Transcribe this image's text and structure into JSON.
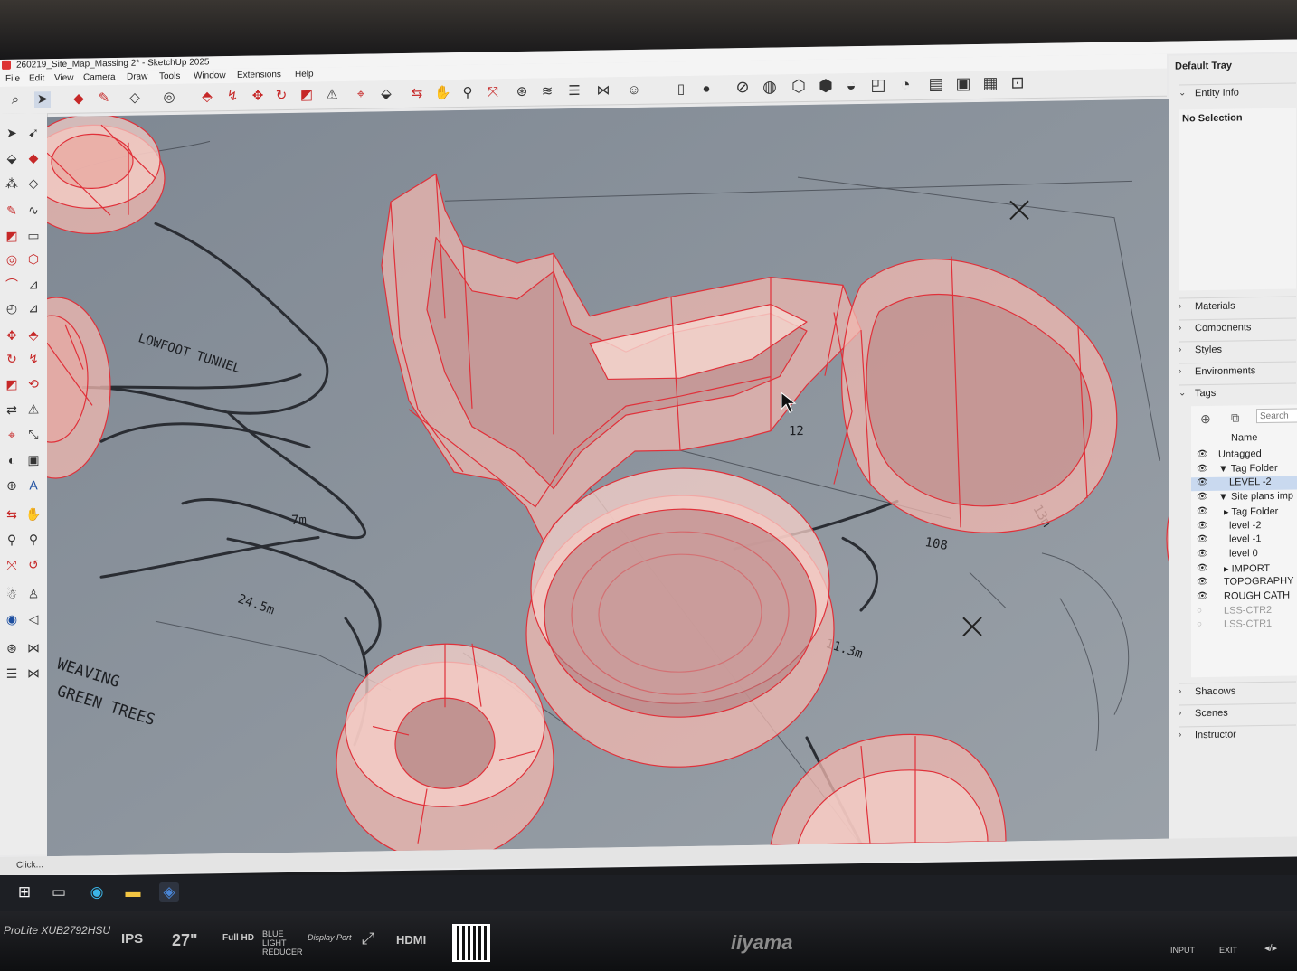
{
  "window": {
    "title": "260219_Site_Map_Massing 2* - SketchUp 2025"
  },
  "menu": [
    "File",
    "Edit",
    "View",
    "Camera",
    "Draw",
    "Tools",
    "Window",
    "Extensions",
    "Help"
  ],
  "tray": {
    "title": "Default Tray",
    "entity_info": {
      "label": "Entity Info",
      "status": "No Selection"
    },
    "panels_collapsed": [
      "Materials",
      "Components",
      "Styles",
      "Environments"
    ],
    "tags": {
      "label": "Tags",
      "search_placeholder": "Search",
      "column_name": "Name",
      "rows": [
        {
          "name": "Untagged",
          "indent": 0,
          "visible": true,
          "selected": false
        },
        {
          "name": "▼ Tag Folder",
          "indent": 0,
          "visible": true,
          "selected": false
        },
        {
          "name": "LEVEL -2",
          "indent": 2,
          "visible": true,
          "selected": true
        },
        {
          "name": "▼ Site plans imp",
          "indent": 0,
          "visible": true,
          "selected": false
        },
        {
          "name": "▸ Tag Folder",
          "indent": 1,
          "visible": true,
          "selected": false
        },
        {
          "name": "level -2",
          "indent": 2,
          "visible": true,
          "selected": false
        },
        {
          "name": "level -1",
          "indent": 2,
          "visible": true,
          "selected": false
        },
        {
          "name": "level 0",
          "indent": 2,
          "visible": true,
          "selected": false
        },
        {
          "name": "▸ IMPORT",
          "indent": 1,
          "visible": true,
          "selected": false
        },
        {
          "name": "TOPOGRAPHY",
          "indent": 1,
          "visible": true,
          "selected": false
        },
        {
          "name": "ROUGH CATH",
          "indent": 1,
          "visible": true,
          "selected": false
        },
        {
          "name": "LSS-CTR2",
          "indent": 1,
          "visible": false,
          "selected": false
        },
        {
          "name": "LSS-CTR1",
          "indent": 1,
          "visible": false,
          "selected": false
        }
      ]
    },
    "panels_bottom": [
      "Shadows",
      "Scenes",
      "Instructor"
    ]
  },
  "statusbar": {
    "text": "Click..."
  },
  "sketch_annotations": [
    "LOWFOOT TUNNEL",
    "24.5m",
    "11.3m",
    "108",
    "13m",
    "7m",
    "12",
    "WEAVING",
    "GREEN TREES"
  ],
  "monitor": {
    "model": "ProLite XUB2792HSU",
    "panel": "IPS",
    "size": "27\"",
    "fullhd": "Full HD",
    "bluelight": "BLUE LIGHT REDUCER",
    "displayport": "Display Port",
    "hdmi": "HDMI",
    "brand": "iiyama",
    "input": "INPUT",
    "exit": "EXIT"
  },
  "colors": {
    "massing_fill": "#f2b8b0",
    "massing_edge": "#e0313a",
    "paper": "#8a929b",
    "ui_bg": "#ececec"
  }
}
